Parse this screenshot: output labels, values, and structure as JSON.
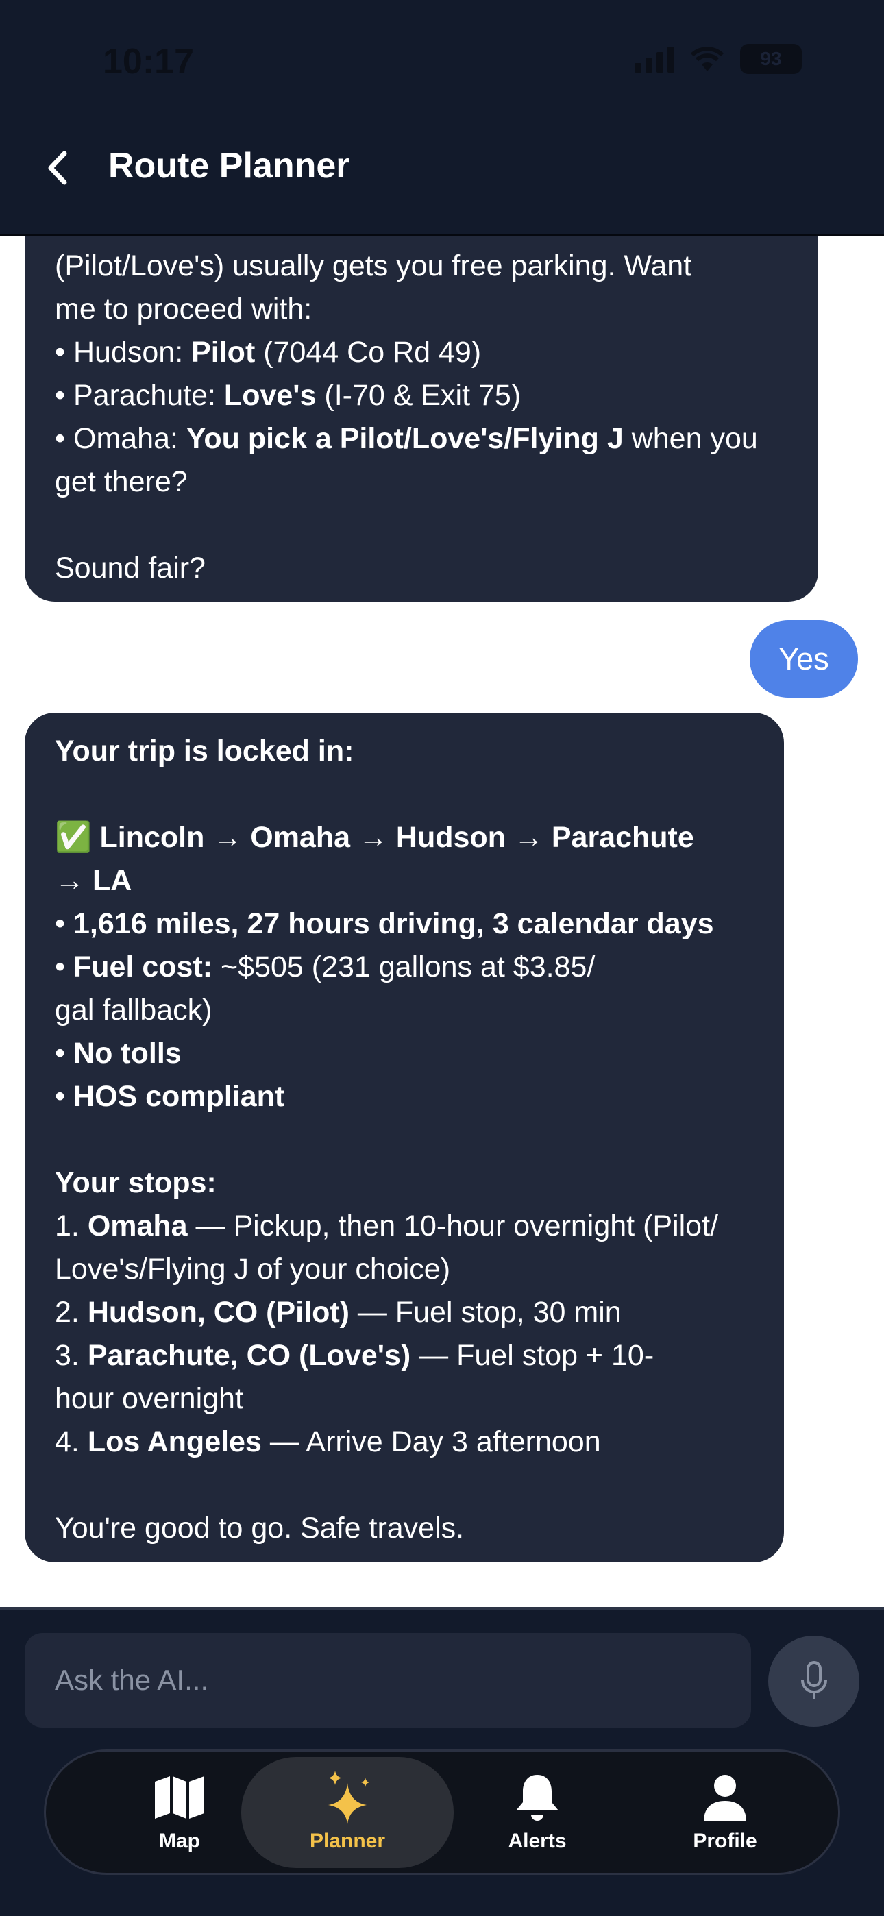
{
  "status_bar": {
    "time": "10:17",
    "battery": "93"
  },
  "header": {
    "title": "Route Planner"
  },
  "messages": {
    "ai_1": {
      "lines": [
        [
          {
            "t": "(Pilot/Love's) usually gets you free parking. Want",
            "b": false
          }
        ],
        [
          {
            "t": "me to proceed with:",
            "b": false
          }
        ],
        [
          {
            "t": "• Hudson: ",
            "b": false
          },
          {
            "t": "Pilot",
            "b": true
          },
          {
            "t": " (7044 Co Rd 49)",
            "b": false
          }
        ],
        [
          {
            "t": "• Parachute: ",
            "b": false
          },
          {
            "t": "Love's",
            "b": true
          },
          {
            "t": " (I-70 & Exit 75)",
            "b": false
          }
        ],
        [
          {
            "t": "• Omaha: ",
            "b": false
          },
          {
            "t": "You pick a Pilot/Love's/Flying J",
            "b": true
          },
          {
            "t": " when you",
            "b": false
          }
        ],
        [
          {
            "t": "get there?",
            "b": false
          }
        ],
        [],
        [
          {
            "t": "Sound fair?",
            "b": false
          }
        ]
      ]
    },
    "user_1": {
      "text": "Yes"
    },
    "ai_2": {
      "lines": [
        [
          {
            "t": "Your trip is locked in:",
            "b": true
          }
        ],
        [],
        [
          {
            "t": "✅ Lincoln → Omaha → Hudson → Parachute",
            "b": true
          }
        ],
        [
          {
            "t": "→ LA",
            "b": true
          }
        ],
        [
          {
            "t": "• ",
            "b": false
          },
          {
            "t": "1,616 miles, 27 hours driving, 3 calendar days",
            "b": true
          }
        ],
        [
          {
            "t": "• ",
            "b": false
          },
          {
            "t": "Fuel cost:",
            "b": true
          },
          {
            "t": " ~$505 (231 gallons at $3.85/",
            "b": false
          }
        ],
        [
          {
            "t": "gal fallback)",
            "b": false
          }
        ],
        [
          {
            "t": "• ",
            "b": false
          },
          {
            "t": "No tolls",
            "b": true
          }
        ],
        [
          {
            "t": "• ",
            "b": false
          },
          {
            "t": "HOS compliant",
            "b": true
          }
        ],
        [],
        [
          {
            "t": "Your stops:",
            "b": true
          }
        ],
        [
          {
            "t": "1. ",
            "b": false
          },
          {
            "t": "Omaha",
            "b": true
          },
          {
            "t": " — Pickup, then 10-hour overnight (Pilot/",
            "b": false
          }
        ],
        [
          {
            "t": "Love's/Flying J of your choice)",
            "b": false
          }
        ],
        [
          {
            "t": "2. ",
            "b": false
          },
          {
            "t": "Hudson, CO (Pilot)",
            "b": true
          },
          {
            "t": " — Fuel stop, 30 min",
            "b": false
          }
        ],
        [
          {
            "t": "3. ",
            "b": false
          },
          {
            "t": "Parachute, CO (Love's)",
            "b": true
          },
          {
            "t": " — Fuel stop + 10-",
            "b": false
          }
        ],
        [
          {
            "t": "hour overnight",
            "b": false
          }
        ],
        [
          {
            "t": "4. ",
            "b": false
          },
          {
            "t": "Los Angeles",
            "b": true
          },
          {
            "t": " — Arrive Day 3 afternoon",
            "b": false
          }
        ],
        [],
        [
          {
            "t": "You're good to go. Safe travels.",
            "b": false
          }
        ]
      ]
    }
  },
  "composer": {
    "placeholder": "Ask the AI..."
  },
  "tabs": [
    {
      "label": "Map",
      "icon": "map-icon"
    },
    {
      "label": "Planner",
      "icon": "sparkles-icon",
      "active": true
    },
    {
      "label": "Alerts",
      "icon": "bell-icon"
    },
    {
      "label": "Profile",
      "icon": "person-icon"
    }
  ],
  "colors": {
    "header_bg": "#121a2b",
    "ai_bubble": "#21283a",
    "user_bubble": "#4f82e8",
    "active_tab": "#f4c24a"
  }
}
